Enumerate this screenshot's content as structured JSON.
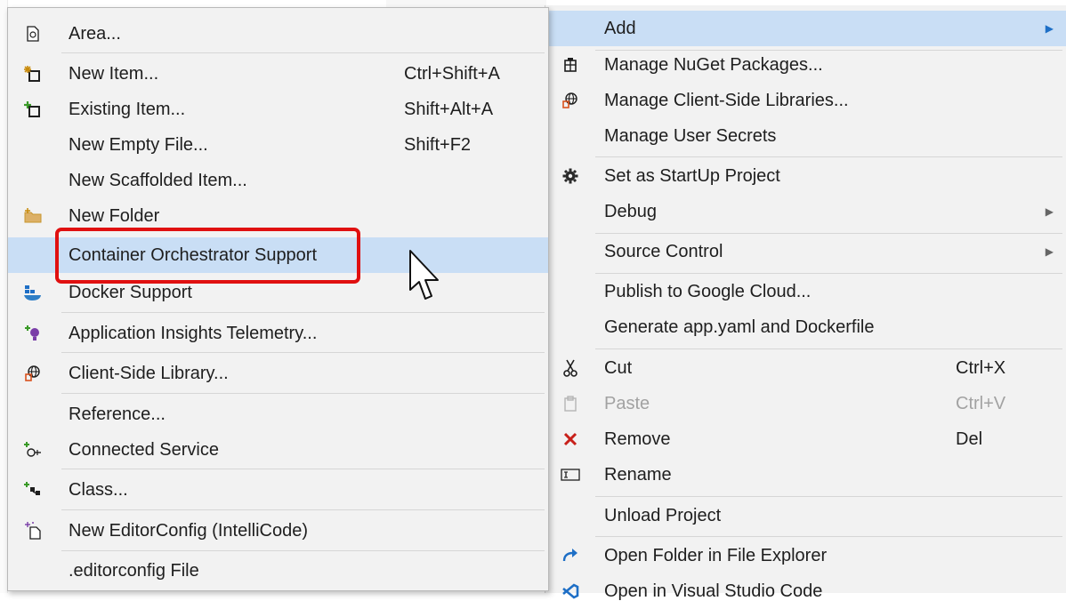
{
  "left_menu": {
    "items": [
      {
        "label": "Area...",
        "shortcut": "",
        "icon": "area-icon"
      },
      {
        "label": "New Item...",
        "shortcut": "Ctrl+Shift+A",
        "icon": "new-item-icon"
      },
      {
        "label": "Existing Item...",
        "shortcut": "Shift+Alt+A",
        "icon": "existing-item-icon"
      },
      {
        "label": "New Empty File...",
        "shortcut": "Shift+F2",
        "icon": ""
      },
      {
        "label": "New Scaffolded Item...",
        "shortcut": "",
        "icon": ""
      },
      {
        "label": "New Folder",
        "shortcut": "",
        "icon": "new-folder-icon"
      },
      {
        "label": "Container Orchestrator Support",
        "shortcut": "",
        "icon": ""
      },
      {
        "label": "Docker Support",
        "shortcut": "",
        "icon": "docker-icon"
      },
      {
        "label": "Application Insights Telemetry...",
        "shortcut": "",
        "icon": "app-insights-icon"
      },
      {
        "label": "Client-Side Library...",
        "shortcut": "",
        "icon": "client-library-icon"
      },
      {
        "label": "Reference...",
        "shortcut": "",
        "icon": ""
      },
      {
        "label": "Connected Service",
        "shortcut": "",
        "icon": "connected-service-icon"
      },
      {
        "label": "Class...",
        "shortcut": "",
        "icon": "class-icon"
      },
      {
        "label": "New EditorConfig (IntelliCode)",
        "shortcut": "",
        "icon": "editorconfig-icon"
      },
      {
        "label": ".editorconfig File",
        "shortcut": "",
        "icon": ""
      }
    ]
  },
  "right_menu": {
    "items": [
      {
        "label": "Add",
        "shortcut": "",
        "icon": "",
        "submenu": true
      },
      {
        "label": "Manage NuGet Packages...",
        "shortcut": "",
        "icon": "nuget-icon"
      },
      {
        "label": "Manage Client-Side Libraries...",
        "shortcut": "",
        "icon": "client-library-icon"
      },
      {
        "label": "Manage User Secrets",
        "shortcut": "",
        "icon": ""
      },
      {
        "label": "Set as StartUp Project",
        "shortcut": "",
        "icon": "gear-icon"
      },
      {
        "label": "Debug",
        "shortcut": "",
        "icon": "",
        "submenu": true
      },
      {
        "label": "Source Control",
        "shortcut": "",
        "icon": "",
        "submenu": true
      },
      {
        "label": "Publish to Google Cloud...",
        "shortcut": "",
        "icon": ""
      },
      {
        "label": "Generate app.yaml and Dockerfile",
        "shortcut": "",
        "icon": ""
      },
      {
        "label": "Cut",
        "shortcut": "Ctrl+X",
        "icon": "scissors-icon"
      },
      {
        "label": "Paste",
        "shortcut": "Ctrl+V",
        "icon": "paste-icon",
        "disabled": true
      },
      {
        "label": "Remove",
        "shortcut": "Del",
        "icon": "remove-icon"
      },
      {
        "label": "Rename",
        "shortcut": "",
        "icon": "rename-icon"
      },
      {
        "label": "Unload Project",
        "shortcut": "",
        "icon": ""
      },
      {
        "label": "Open Folder in File Explorer",
        "shortcut": "",
        "icon": "open-folder-icon"
      },
      {
        "label": "Open in Visual Studio Code",
        "shortcut": "",
        "icon": "vscode-icon"
      }
    ]
  },
  "colors": {
    "menu_bg": "#f2f2f2",
    "highlight": "#c9def5",
    "callout": "#e01010",
    "remove_red": "#c8201a",
    "accent_blue": "#1e6fc6"
  }
}
